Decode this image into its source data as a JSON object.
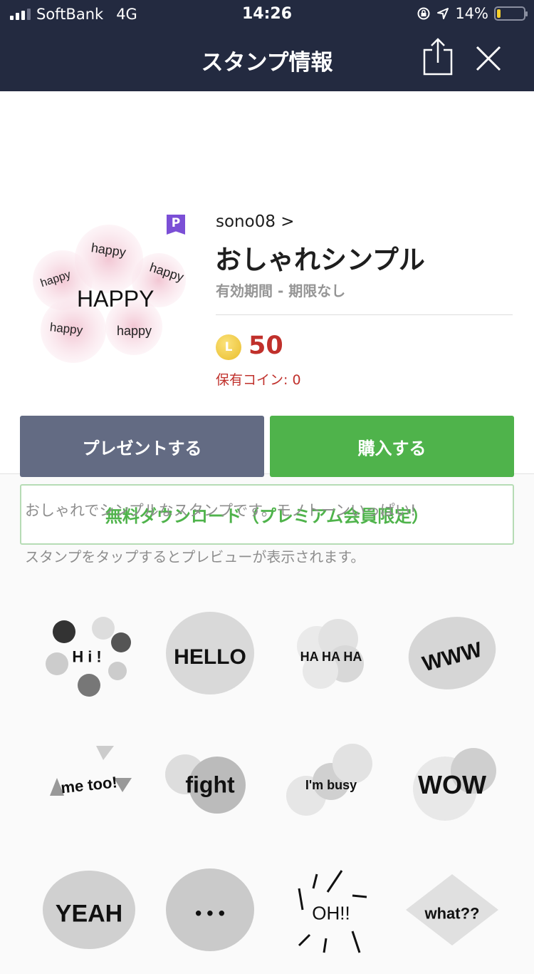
{
  "status_bar": {
    "carrier": "SoftBank",
    "network": "4G",
    "time": "14:26",
    "battery_percent": "14%",
    "battery_level": 0.14,
    "signal_bars": 3,
    "signal_max": 4
  },
  "header": {
    "title": "スタンプ情報",
    "share_icon": "share-icon",
    "close_icon": "close-icon"
  },
  "product": {
    "badge": "P",
    "author": "sono08 >",
    "name": "おしゃれシンプル",
    "validity": "有効期間 - 期限なし",
    "coin_symbol": "L",
    "price": "50",
    "owned_coins": "保有コイン: 0",
    "thumbnail": {
      "main_text": "HAPPY",
      "small_text": "happy"
    }
  },
  "actions": {
    "present_label": "プレゼントする",
    "buy_label": "購入する",
    "free_download_label": "無料ダウンロード（プレミアム会員限定）"
  },
  "description": {
    "text": "おしゃれでシンプルなスタンプです。モノトーンいっぱい!",
    "hint": "スタンプをタップするとプレビューが表示されます。"
  },
  "stamps": [
    {
      "label": "Hi!"
    },
    {
      "label": "HELLO"
    },
    {
      "label": "HA HA HA"
    },
    {
      "label": "WWW"
    },
    {
      "label": "me too!"
    },
    {
      "label": "fight"
    },
    {
      "label": "I'm busy"
    },
    {
      "label": "WOW"
    },
    {
      "label": "YEAH"
    },
    {
      "label": "• • •"
    },
    {
      "label": "OH!!"
    },
    {
      "label": "what??"
    }
  ],
  "colors": {
    "header_bg": "#232a40",
    "accent_green": "#4fb34b",
    "present_gray": "#636b83",
    "price_red": "#c0302b",
    "premium_purple": "#7b4fd6"
  }
}
